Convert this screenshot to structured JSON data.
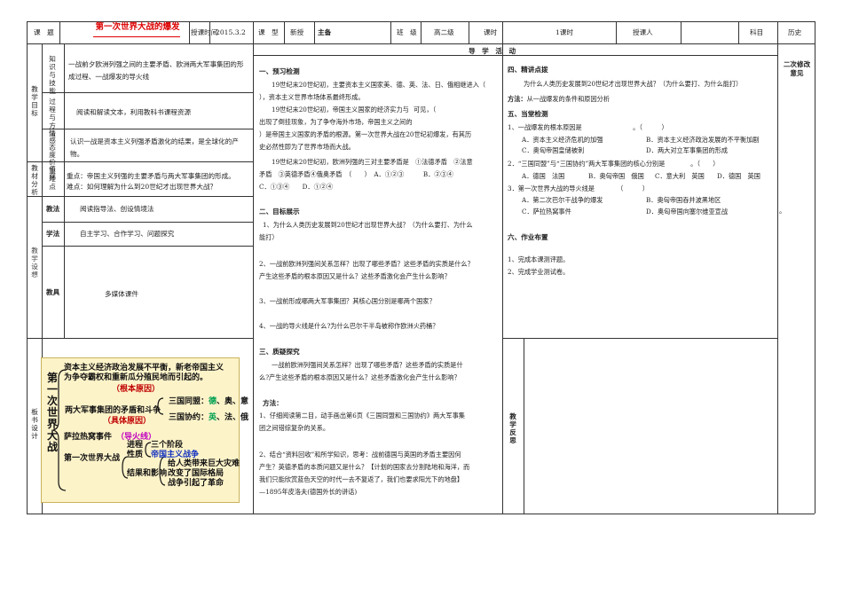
{
  "header": {
    "lesson_label": "课　题",
    "lesson_title": "第一次世界大战的爆发",
    "time_label": "授课时间",
    "time_value": "2015.3.2",
    "type_label": "课　型",
    "type_value": "新授",
    "preparer": "主备",
    "class_label": "班　级",
    "class_value": "高二级",
    "hours_label": "课时",
    "hours_value": "1课时",
    "teacher_label": "授课人",
    "subject_label": "科目",
    "subject_value": "历史"
  },
  "left": {
    "goals_title": "教学目标",
    "goal1_label": "知识与技能",
    "goal1_text": "一战前夕欧洲列强之间的主要矛盾、欧洲两大军事集团的形成过程、一战爆发的导火线",
    "goal2_label": "过程与方法",
    "goal2_text": "阅读和解读文本，利用教科书课程资源",
    "goal3_label": "情感态度价值观",
    "goal3_text": "认识一战是资本主义列强矛盾激化的结果，是全球化的产物。",
    "analysis_title": "教材分析",
    "keypoint_label": "重难点",
    "keypoint_text1": "重点：帝国主义列强的主要矛盾与两大军事集团的形成。",
    "keypoint_text2": "难点：如何理解为什么到20世纪才出现世界大战？",
    "design_title": "教学设想",
    "method_label": "教法",
    "method_text": "阅读指导法、创设情境法",
    "study_label": "学法",
    "study_text": "自主学习、合作学习、问题探究",
    "tools_label": "教具",
    "tools_text": "多媒体课件",
    "board_title": "板书设计"
  },
  "board": {
    "left_title": "第一次世界大战",
    "line1": "资本主义经济政治发展不平衡，新老帝国主义",
    "line2": "为争夺霸权和重新瓜分殖民地而引起的。",
    "root_cause": "（根本原因）",
    "camps_line": "两大军事集团的矛盾和斗争",
    "camps_cause": "（具体原因）",
    "alliance1_a": "三国同盟：",
    "alliance1_b": "德",
    "alliance1_c": "、奥、意",
    "alliance2_a": "三国协约：",
    "alliance2_b": "英",
    "alliance2_c": "、法、俄",
    "sarajevo": "萨拉热窝事件",
    "fuse": "（导火线）",
    "war": "第一次世界大战",
    "process": "进程",
    "nature": "性质",
    "three_stages": "三个阶段",
    "imperialist": "帝国主义战争",
    "result": "结果和影响",
    "effect1": "给人类带来巨大灾难",
    "effect2": "改变了国际格局",
    "effect3": "战争引起了革命"
  },
  "middle": {
    "activity_header": "导　学　活　动",
    "s1_title": "一、预习检测",
    "s1_p1a": "19世纪末20世纪初，主要资本主义国家美、德、英、法、日、俄相继进入（",
    "s1_p1b": "），资本主义世界市场体系最终形成。",
    "s1_p2a": "19世纪末20世纪初，帝国主义国家的经济实力与　　　　　　的矛盾日益尖锐。可见，（",
    "s1_p2b": "）是帝国主义国家的矛盾的根源。第一次世界大战在20世纪初爆发，有其历",
    "s1_p2c": "史必然性即为了世界市场而大战。",
    "s1_p2d": "出现了倒挂现象，为了争夺海外市场，帝国主义之间的",
    "s1_p3a": "19世纪末20世纪初，欧洲列强的三对主要矛盾是　①法德矛盾　②法意",
    "s1_p3b": "矛盾　③英德矛盾④俄奥矛盾　（　　）　A．①②③　　　B．②③④",
    "s1_p3c": "C．①③④　　D．①②④",
    "s2_title": "二、目标展示",
    "s2_q1a": "1、为什么人类历史发展到20世纪才出现世界大战？（为什么要打、为什么",
    "s2_q1b": "能打）",
    "s2_q2a": "2、一战前欧洲列强间关系怎样？出现了哪些矛盾？这些矛盾的实质是什么？",
    "s2_q2b": "产生这些矛盾的根本原因又是什么？这些矛盾激化会产生什么影响？",
    "s2_q3": "3、一战前形成哪两大军事集团？其核心国分别是哪两个国家？",
    "s2_q4": "4、一战的导火线是什么?为什么巴尔干半岛被称作欧洲火药桶？",
    "s3_title": "三、质疑探究",
    "s3_p1a": "一战前欧洲列强间关系怎样？出现了哪些矛盾？这些矛盾的实质是什",
    "s3_p1b": "么?产生这些矛盾的根本原因又是什么？这些矛盾激化会产生什么影响？",
    "method_title": "方法：",
    "m1a": "1、仔细阅读第二目，动手画出第6页《三国同盟和三国协约》两大军事集",
    "m1b": "团之间错综复杂的关系。",
    "m2a": "2、结合“资料回收”和所学知识，思考：战前德国与英国的矛盾主要因何",
    "m2b": "产生？英德矛盾的本质问题又是什么？【计划的国家去分割陆地和海洋，而",
    "m2c": "我们只能欣赏蓝色天空的时代一去不复返了，我们也要求阳光下的地盘】",
    "m2d": "—1895年皮洛夫(德国外长的讲话)"
  },
  "right": {
    "s4_title": "四、精讲点拨",
    "s4_p1": "为什么人类历史发展到20世纪才出现世界大战？（为什么要打、为什么能打）",
    "s4_method": "方法：",
    "s4_method_text": "从一战爆发的条件和原因分析",
    "s5_title": "五、当堂检测",
    "q1": "1、一战爆发的根本原因是　　　　　　　　。（　　　）",
    "q1_a": "A．资本主义经济危机的加强",
    "q1_b": "B．资本主义经济政治发展的不平衡加剧",
    "q1_c": "C．奥匈帝国皇储被刺",
    "q1_d": "D．两大对立军事集团的形成",
    "q2": "2．“三国同盟”与“三国协约”两大军事集团的核心分别是　　　　。（　　）",
    "q2_a": "A．德国　法国",
    "q2_b": "B．奥匈帝国　俄国",
    "q2_c": "C．意大利　英国",
    "q2_d": "D．德国　英国",
    "q3": "3．第一次世界大战的导火线是　　　　（　　　）",
    "q3_a": "A．第二次巴尔干战争的爆发",
    "q3_b": "B．奥匈帝国吞并波黑地区",
    "q3_c": "C．萨拉热窝事件",
    "q3_d": "D．奥匈帝国向塞尔维亚宣战",
    "s6_title": "六、作业布置",
    "hw1": "1、完成本课测评题。",
    "hw2": "2、完成学业测试卷。",
    "second_edit": "二次修改意见",
    "reflection": "教学反思",
    "dot": "。"
  },
  "colors": {
    "title_red": "#d00000",
    "board_bg": "#fdf3c9",
    "board_red": "#c00000",
    "board_green": "#00a050",
    "board_blue": "#1030c0",
    "board_magenta": "#c000c0"
  }
}
